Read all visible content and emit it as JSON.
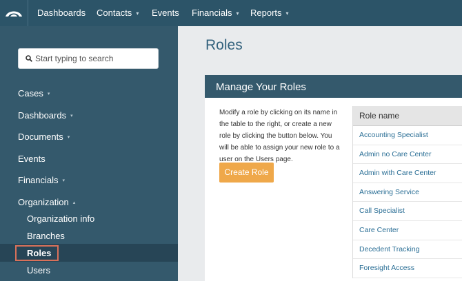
{
  "topnav": {
    "items": [
      {
        "label": "Dashboards",
        "has_caret": false
      },
      {
        "label": "Contacts",
        "has_caret": true
      },
      {
        "label": "Events",
        "has_caret": false
      },
      {
        "label": "Financials",
        "has_caret": true
      },
      {
        "label": "Reports",
        "has_caret": true
      }
    ],
    "caret": "▾"
  },
  "sidebar": {
    "search_placeholder": "Start typing to search",
    "items": [
      {
        "label": "Cases",
        "caret": "▾"
      },
      {
        "label": "Dashboards",
        "caret": "▾"
      },
      {
        "label": "Documents",
        "caret": "▾"
      },
      {
        "label": "Events",
        "caret": ""
      },
      {
        "label": "Financials",
        "caret": "▾"
      },
      {
        "label": "Organization",
        "caret": "▴"
      }
    ],
    "subitems": [
      "Organization info",
      "Branches",
      "Roles",
      "Users"
    ],
    "active_subitem": "Roles"
  },
  "main": {
    "title": "Roles",
    "panel_title": "Manage Your Roles",
    "description": "Modify a role by clicking on its name in the table to the right, or create a new role by clicking the button below. You will be able to assign your new role to a user on the Users page.",
    "create_button": "Create Role",
    "table_header": "Role name",
    "roles": [
      "Accounting Specialist",
      "Admin no Care Center",
      "Admin with Care Center",
      "Answering Service",
      "Call Specialist",
      "Care Center",
      "Decedent Tracking",
      "Foresight Access"
    ]
  },
  "colors": {
    "nav_bg": "#2c5468",
    "sidebar_bg": "#34596c",
    "accent_button": "#efa84a",
    "highlight_border": "#d9715a",
    "link": "#2a6e95"
  }
}
